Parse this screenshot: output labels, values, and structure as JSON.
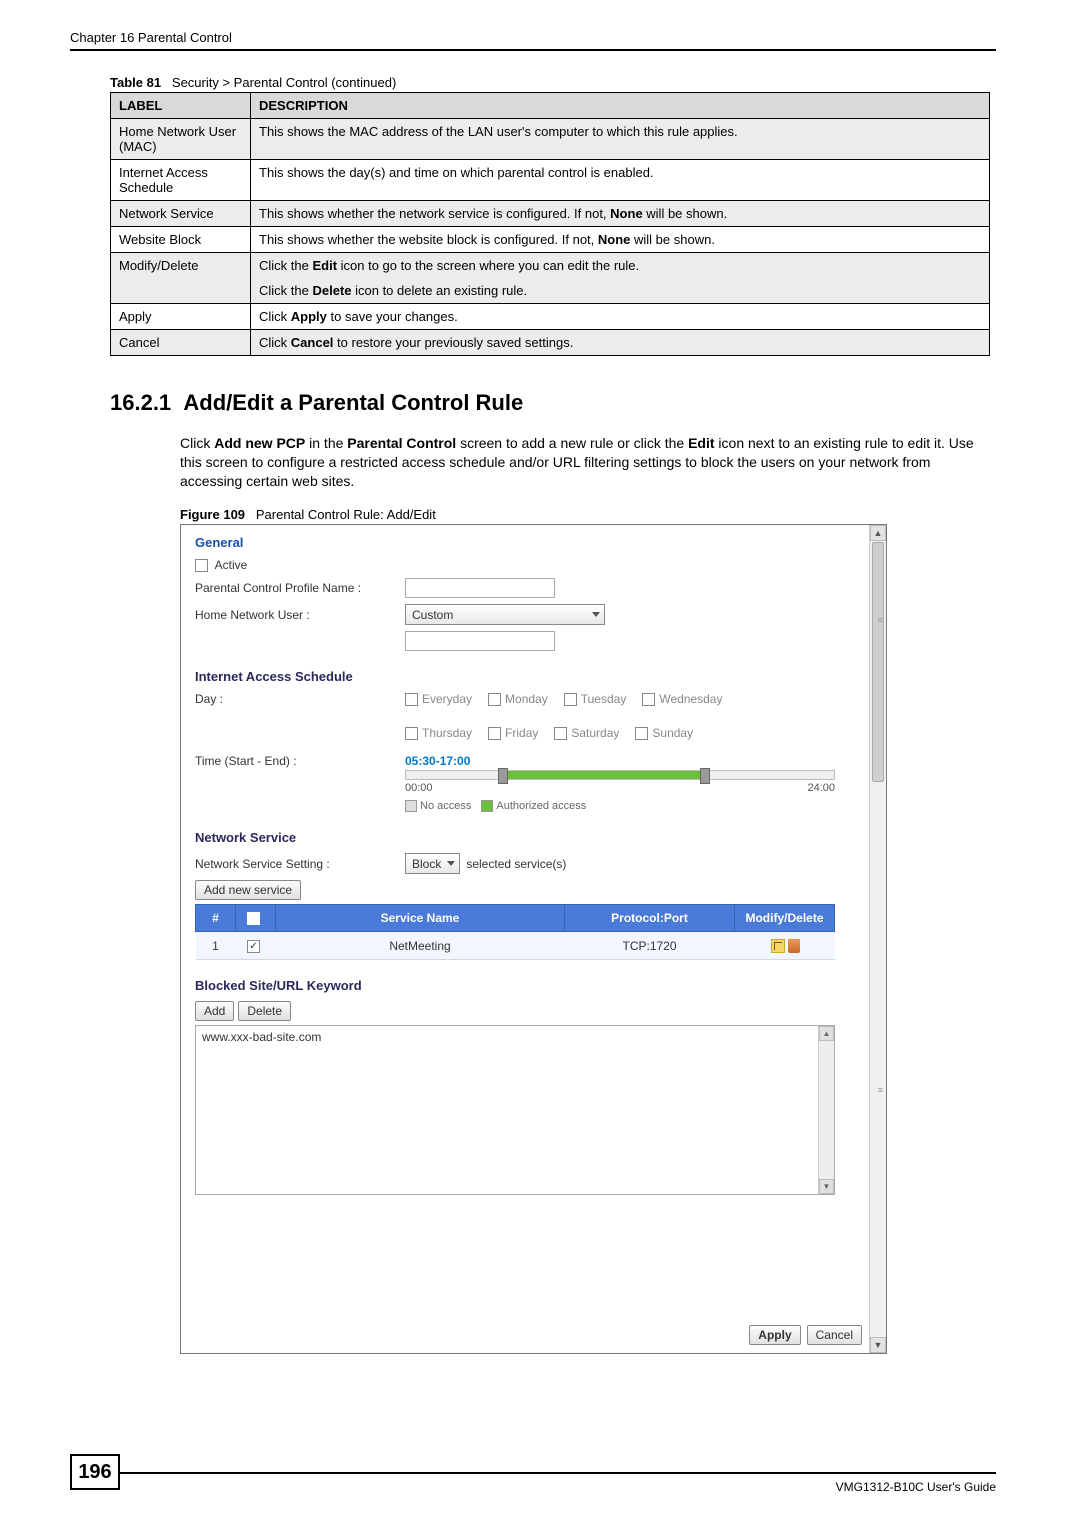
{
  "header": {
    "chapter": "Chapter 16 Parental Control"
  },
  "table": {
    "caption_prefix": "Table 81",
    "caption": "Security > Parental Control (continued)",
    "cols": {
      "label": "LABEL",
      "desc": "DESCRIPTION"
    },
    "rows": [
      {
        "label": "Home Network User (MAC)",
        "desc": "This shows the MAC address of the LAN user's computer to which this rule applies."
      },
      {
        "label": "Internet Access Schedule",
        "desc": "This shows the day(s) and time on which parental control is enabled."
      },
      {
        "label": "Network Service",
        "desc_pre": "This shows whether the network service is configured. If not, ",
        "desc_bold": "None",
        "desc_post": " will be shown."
      },
      {
        "label": "Website Block",
        "desc_pre": "This shows whether the website block is configured. If not, ",
        "desc_bold": "None",
        "desc_post": " will be shown."
      },
      {
        "label": "Modify/Delete",
        "desc_l1_pre": "Click the ",
        "desc_l1_bold": "Edit",
        "desc_l1_post": " icon to go to the screen where you can edit the rule.",
        "desc_l2_pre": "Click the ",
        "desc_l2_bold": "Delete",
        "desc_l2_post": " icon to delete an existing rule."
      },
      {
        "label": "Apply",
        "desc_pre": "Click ",
        "desc_bold": "Apply",
        "desc_post": " to save your changes."
      },
      {
        "label": "Cancel",
        "desc_pre": "Click ",
        "desc_bold": "Cancel",
        "desc_post": " to restore your previously saved settings."
      }
    ]
  },
  "subsection": {
    "number": "16.2.1",
    "title": "Add/Edit a Parental Control Rule",
    "para": {
      "t1": "Click ",
      "b1": "Add new PCP",
      "t2": " in the ",
      "b2": "Parental Control",
      "t3": " screen to add a new rule or click the ",
      "b3": "Edit",
      "t4": " icon next to an existing rule to edit it. Use this screen to configure a restricted access schedule and/or URL filtering settings to block the users on your network from accessing certain web sites."
    }
  },
  "figure": {
    "caption_prefix": "Figure 109",
    "caption": "Parental Control Rule: Add/Edit"
  },
  "ui": {
    "general": {
      "heading": "General",
      "active": "Active",
      "profile_name_label": "Parental Control Profile Name :",
      "profile_name_value": "",
      "home_user_label": "Home Network User :",
      "home_user_value": "Custom",
      "home_user_input": ""
    },
    "schedule": {
      "heading": "Internet Access Schedule",
      "day_label": "Day :",
      "days": [
        "Everyday",
        "Monday",
        "Tuesday",
        "Wednesday",
        "Thursday",
        "Friday",
        "Saturday",
        "Sunday"
      ],
      "time_label": "Time (Start - End) :",
      "time_value": "05:30-17:00",
      "scale_start": "00:00",
      "scale_end": "24:00",
      "legend_no": "No access",
      "legend_yes": "Authorized access"
    },
    "netservice": {
      "heading": "Network Service",
      "setting_label": "Network Service Setting :",
      "setting_value": "Block",
      "setting_suffix": "selected service(s)",
      "add_btn": "Add new service",
      "cols": {
        "num": "#",
        "chk": "",
        "name": "Service Name",
        "proto": "Protocol:Port",
        "mod": "Modify/Delete"
      },
      "rows": [
        {
          "num": "1",
          "checked": true,
          "name": "NetMeeting",
          "proto": "TCP:1720"
        }
      ]
    },
    "blocked": {
      "heading": "Blocked Site/URL Keyword",
      "add": "Add",
      "del": "Delete",
      "entry": "www.xxx-bad-site.com"
    },
    "buttons": {
      "apply": "Apply",
      "cancel": "Cancel"
    },
    "scroll_ticks": {
      "top": "▲",
      "bot": "▼",
      "mid1": "≡",
      "mid2": "≡"
    }
  },
  "footer": {
    "page": "196",
    "guide": "VMG1312-B10C User's Guide"
  }
}
